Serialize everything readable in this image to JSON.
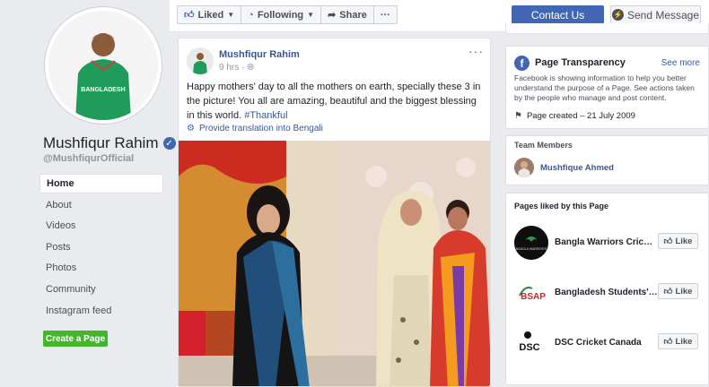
{
  "profile": {
    "name": "Mushfiqur Rahim",
    "handle": "@MushfiqurOfficial",
    "jersey_text": "BANGLADESH"
  },
  "nav": {
    "items": [
      "Home",
      "About",
      "Videos",
      "Posts",
      "Photos",
      "Community",
      "Instagram feed"
    ],
    "active": "Home",
    "create_page_label": "Create a Page"
  },
  "topbar": {
    "liked_label": "Liked",
    "following_label": "Following",
    "share_label": "Share",
    "more_label": "···",
    "contact_label": "Contact Us",
    "message_label": "Send Message"
  },
  "post": {
    "author": "Mushfiqur Rahim",
    "time": "9 hrs ·",
    "text": "Happy mothers' day to all the mothers on earth, specially these 3 in the picture! You all are amazing, beautiful and the biggest blessing in this world.",
    "hashtag": "#Thankful",
    "translate_label": "Provide translation into Bengali",
    "more_label": "···"
  },
  "transparency": {
    "title": "Page Transparency",
    "see_more": "See more",
    "description": "Facebook is showing information to help you better understand the purpose of a Page. See actions taken by the people who manage and post content.",
    "page_created": "Page created – 21 July 2009"
  },
  "team": {
    "title": "Team Members",
    "members": [
      "Mushfique Ahmed"
    ]
  },
  "liked_pages": {
    "title": "Pages liked by this Page",
    "like_label": "Like",
    "items": [
      {
        "name": "Bangla Warriors Cric…",
        "logo_text": "BANGLA WARRIORS"
      },
      {
        "name": "Bangladesh Students'…",
        "logo_text": "BSAP"
      },
      {
        "name": "DSC Cricket Canada",
        "logo_text": "DSC"
      }
    ]
  },
  "colors": {
    "brand": "#4267b2",
    "link": "#365899",
    "create_button": "#42b72a"
  }
}
